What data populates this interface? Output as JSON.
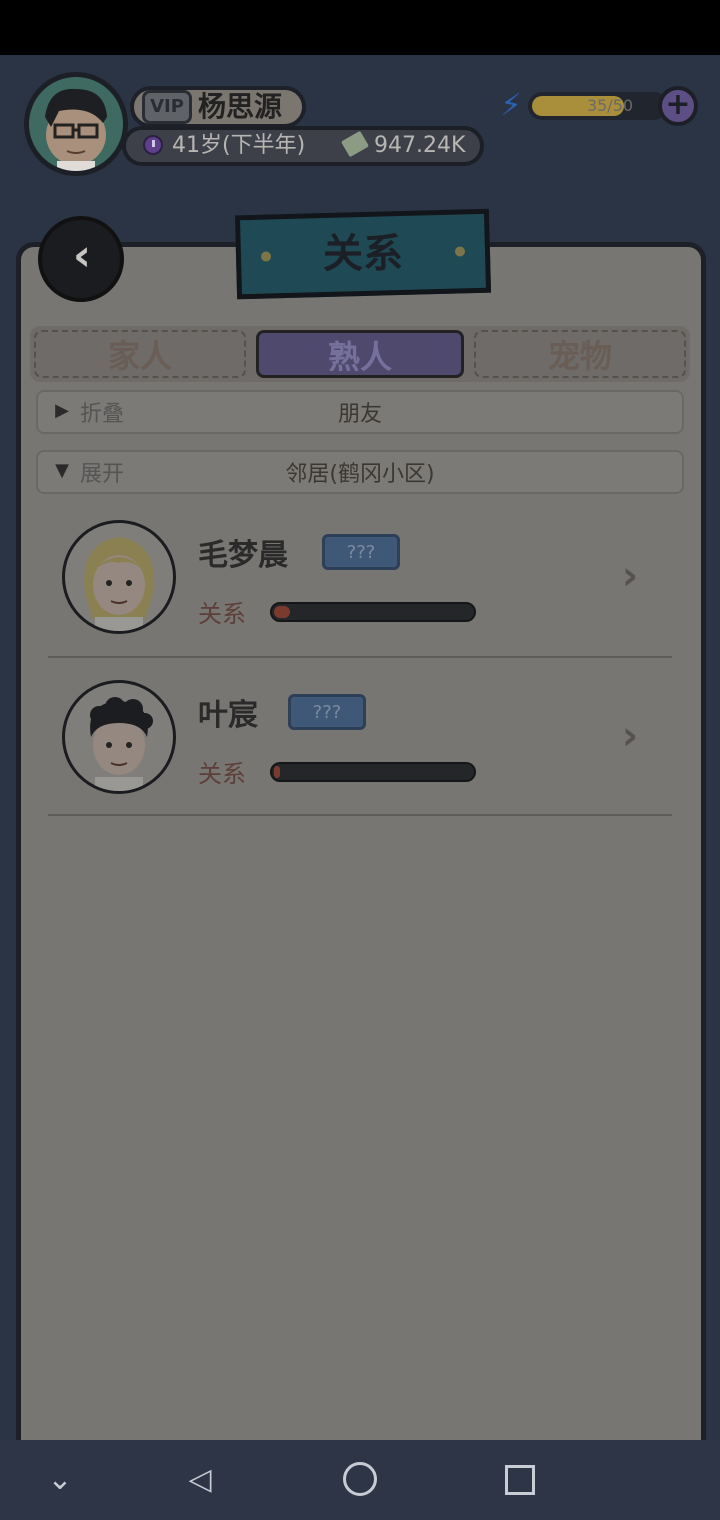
{
  "player": {
    "vip": "VIP",
    "name": "杨思源",
    "age": "41岁(下半年)",
    "money": "947.24K",
    "energy": "35/50",
    "energy_fraction": 0.7
  },
  "page": {
    "title": "关系"
  },
  "tabs": [
    {
      "label": "家人",
      "active": false
    },
    {
      "label": "熟人",
      "active": true
    },
    {
      "label": "宠物",
      "active": false
    }
  ],
  "sections": [
    {
      "state": "折叠",
      "title": "朋友",
      "arrow": "▶"
    },
    {
      "state": "展开",
      "title": "邻居(鹤冈小区)",
      "arrow": "▼"
    }
  ],
  "contacts": [
    {
      "name": "毛梦晨",
      "tag": "???",
      "rel_label": "关系",
      "relationship": 0.08,
      "avatar": "blonde-girl-avatar"
    },
    {
      "name": "叶宸",
      "tag": "???",
      "rel_label": "关系",
      "relationship": 0.03,
      "avatar": "curly-hair-boy-avatar"
    }
  ],
  "colors": {
    "panel": "#787672",
    "title_board": "#1f4a55",
    "active_tab": "#4f4a6d",
    "energy": "#a98f3b",
    "unknown_tag": "#3f5878"
  }
}
